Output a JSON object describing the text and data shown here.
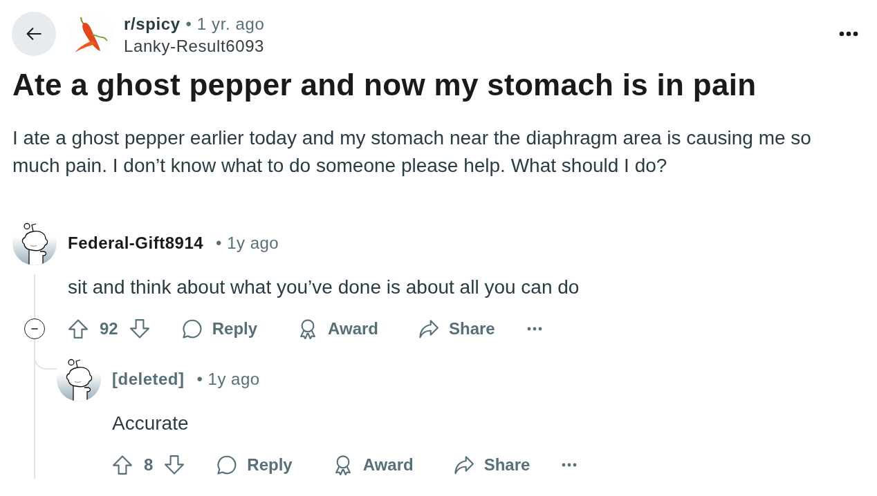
{
  "header": {
    "subreddit": "r/spicy",
    "time": "• 1 yr. ago",
    "author": "Lanky-Result6093"
  },
  "post": {
    "title": "Ate a ghost pepper and now my stomach is in pain",
    "body": "I ate a ghost pepper earlier today and my stomach near the diaphragm area is causing me so much pain. I don’t know what to do someone please help. What should I do?"
  },
  "comments": [
    {
      "author": "Federal-Gift8914",
      "deleted": false,
      "time": "• 1y ago",
      "text": "sit and think about what you’ve done is about all you can do",
      "score": "92",
      "expanded": true,
      "actions": [
        {
          "kind": "reply",
          "label": "Reply"
        },
        {
          "kind": "award",
          "label": "Award"
        },
        {
          "kind": "share",
          "label": "Share"
        }
      ],
      "children": [
        {
          "author": "[deleted]",
          "deleted": true,
          "time": "• 1y ago",
          "text": "Accurate",
          "score": "8",
          "actions": [
            {
              "kind": "reply",
              "label": "Reply"
            },
            {
              "kind": "award",
              "label": "Award"
            },
            {
              "kind": "share",
              "label": "Share"
            }
          ]
        }
      ]
    }
  ]
}
